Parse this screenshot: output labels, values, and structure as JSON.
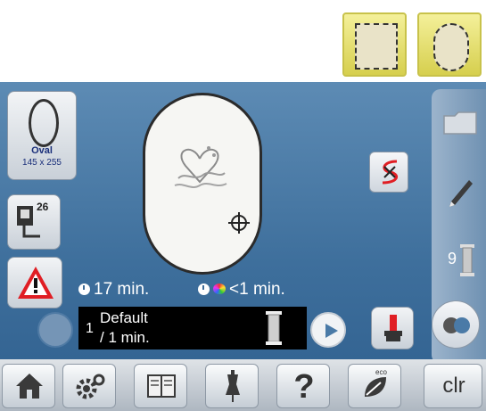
{
  "top_hoop_options": [
    "rectangular-hoop-icon",
    "oval-hoop-icon"
  ],
  "shape_button": {
    "name": "Oval",
    "size": "145 x 255"
  },
  "speed_button": {
    "number": "26"
  },
  "time_info": {
    "stitch_time": "17 min.",
    "color_change_time": "<1 min."
  },
  "color_info": {
    "index": "1",
    "name": "Default",
    "time": "/ 1 min."
  },
  "right_column": {
    "bobbin_label": "9"
  },
  "bottom_bar": {
    "help_label": "?",
    "eco_label": "eco",
    "clear_label": "clr"
  },
  "colors": {
    "screen_blue": "#4a7aa7",
    "hoop_highlight": "#f4f09a",
    "alert_red": "#e01e24"
  }
}
